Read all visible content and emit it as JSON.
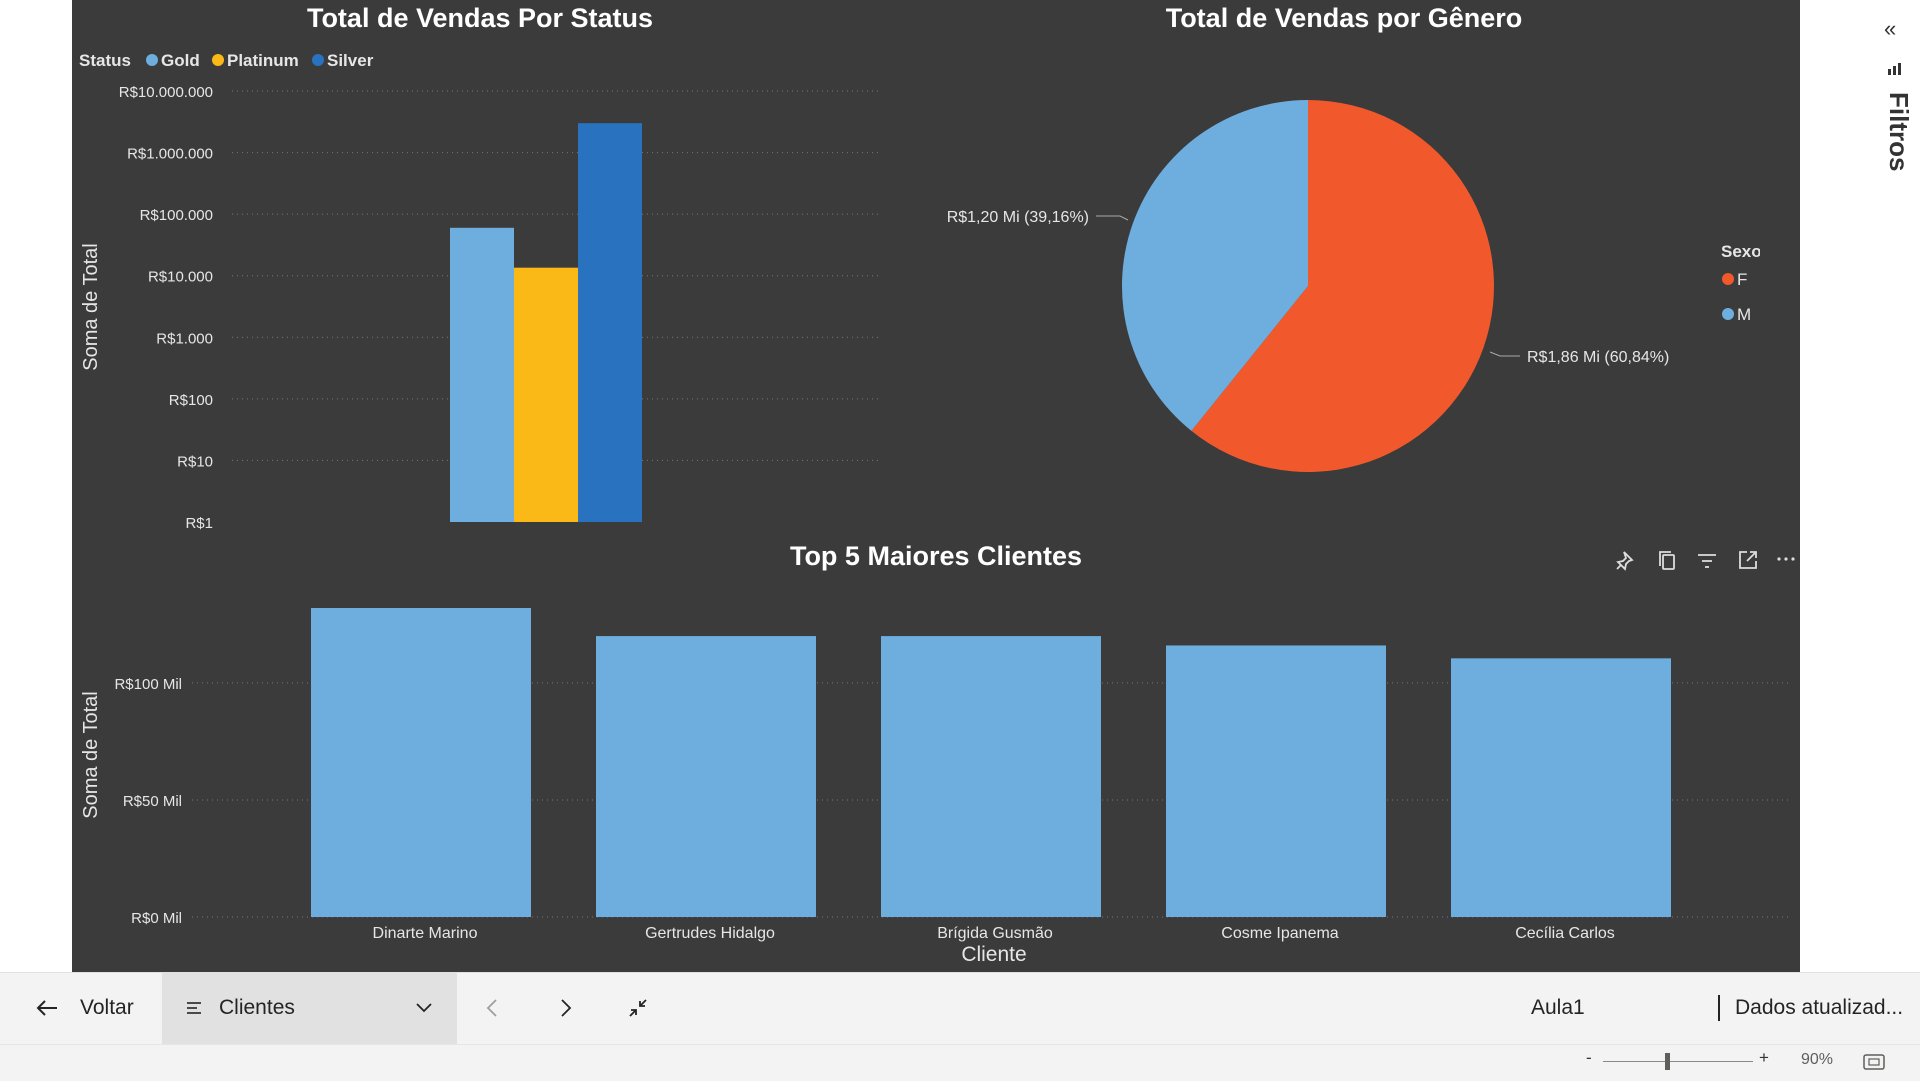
{
  "colors": {
    "gold": "#6eaedf",
    "platinum": "#fbb917",
    "silver": "#2872c0",
    "female": "#f1582c",
    "male": "#6eaedf",
    "canvas": "#3b3b3b",
    "grid": "#777777"
  },
  "status_chart": {
    "title": "Total de Vendas Por Status",
    "legend_title": "Status",
    "legend": [
      "Gold",
      "Platinum",
      "Silver"
    ],
    "ylabel": "Soma de Total",
    "ticks": [
      "R$10.000.000",
      "R$1.000.000",
      "R$100.000",
      "R$10.000",
      "R$1.000",
      "R$100",
      "R$10",
      "R$1"
    ]
  },
  "gender_chart": {
    "title": "Total de Vendas por Gênero",
    "legend_title": "Sexo",
    "legend": [
      "F",
      "M"
    ],
    "label_f": "R$1,86 Mi (60,84%)",
    "label_m": "R$1,20 Mi (39,16%)"
  },
  "top5_chart": {
    "title": "Top 5 Maiores Clientes",
    "ylabel": "Soma de Total",
    "xlabel": "Cliente",
    "ticks": [
      "R$100 Mil",
      "R$50 Mil",
      "R$0 Mil"
    ],
    "categories": [
      "Dinarte Marino",
      "Gertrudes Hidalgo",
      "Brígida Gusmão",
      "Cosme Ipanema",
      "Cecília Carlos"
    ],
    "icons": [
      "pin-icon",
      "copy-icon",
      "filter-icon",
      "focus-mode-icon",
      "more-options-icon"
    ]
  },
  "chart_data": [
    {
      "type": "bar",
      "title": "Total de Vendas Por Status",
      "ylabel": "Soma de Total",
      "yscale": "log",
      "ylim": [
        1,
        10000000
      ],
      "series": [
        {
          "name": "Gold",
          "values": [
            60000
          ]
        },
        {
          "name": "Platinum",
          "values": [
            13500
          ]
        },
        {
          "name": "Silver",
          "values": [
            3000000
          ]
        }
      ],
      "legend": "top-left",
      "grid": true
    },
    {
      "type": "pie",
      "title": "Total de Vendas por Gênero",
      "categories": [
        "F",
        "M"
      ],
      "values": [
        1.86,
        1.2
      ],
      "percent": [
        60.84,
        39.16
      ],
      "labels": [
        "R$1,86 Mi (60,84%)",
        "R$1,20 Mi (39,16%)"
      ],
      "legend": "right"
    },
    {
      "type": "bar",
      "title": "Top 5 Maiores Clientes",
      "xlabel": "Cliente",
      "ylabel": "Soma de Total",
      "categories": [
        "Dinarte Marino",
        "Gertrudes Hidalgo",
        "Brígida Gusmão",
        "Cosme Ipanema",
        "Cecília Carlos"
      ],
      "values": [
        132000,
        120000,
        120000,
        116000,
        110500
      ],
      "ylim": [
        0,
        132000
      ],
      "grid": true
    }
  ],
  "filters": {
    "label": "Filtros"
  },
  "bottom_bar": {
    "back_label": "Voltar",
    "page_label": "Clientes",
    "report_name": "Aula1",
    "refresh_text": "Dados atualizad..."
  },
  "status_bar": {
    "zoom_minus": "-",
    "zoom_plus": "+",
    "zoom_level": "90%"
  }
}
